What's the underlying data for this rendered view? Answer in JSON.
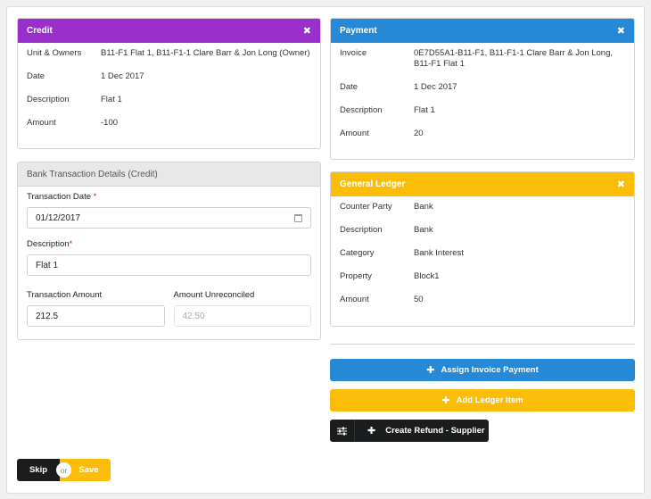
{
  "credit": {
    "title": "Credit",
    "rows": [
      {
        "label": "Unit & Owners",
        "value": "B11-F1 Flat 1, B11-F1-1 Clare Barr & Jon Long (Owner)"
      },
      {
        "label": "Date",
        "value": "1 Dec 2017"
      },
      {
        "label": "Description",
        "value": "Flat 1"
      },
      {
        "label": "Amount",
        "value": "-100"
      }
    ]
  },
  "payment": {
    "title": "Payment",
    "rows": [
      {
        "label": "Invoice",
        "value": "0E7D55A1-B11-F1, B11-F1-1 Clare Barr & Jon Long, B11-F1 Flat 1"
      },
      {
        "label": "Date",
        "value": "1 Dec 2017"
      },
      {
        "label": "Description",
        "value": "Flat 1"
      },
      {
        "label": "Amount",
        "value": "20"
      }
    ]
  },
  "bank": {
    "title": "Bank Transaction Details (Credit)",
    "transaction_date_label": "Transaction Date",
    "transaction_date_value": "01/12/2017",
    "description_label": "Description",
    "description_value": "Flat 1",
    "amount_label": "Transaction Amount",
    "amount_value": "212.5",
    "unreconciled_label": "Amount Unreconciled",
    "unreconciled_value": "42.50",
    "required_mark": "*"
  },
  "ledger": {
    "title": "General Ledger",
    "rows": [
      {
        "label": "Counter Party",
        "value": "Bank"
      },
      {
        "label": "Description",
        "value": "Bank"
      },
      {
        "label": "Category",
        "value": "Bank Interest"
      },
      {
        "label": "Property",
        "value": "Block1"
      },
      {
        "label": "Amount",
        "value": "50"
      }
    ]
  },
  "actions": {
    "assign_invoice": "Assign Invoice Payment",
    "add_ledger": "Add Ledger Item",
    "create_refund": "Create Refund - Supplier"
  },
  "footer": {
    "skip": "Skip",
    "or": "or",
    "save": "Save"
  },
  "icons": {
    "close": "✖",
    "plus": "✚"
  },
  "colors": {
    "credit": "#9b2fcc",
    "payment": "#2589d8",
    "ledger": "#fbbd08",
    "dark": "#1b1c1d"
  }
}
